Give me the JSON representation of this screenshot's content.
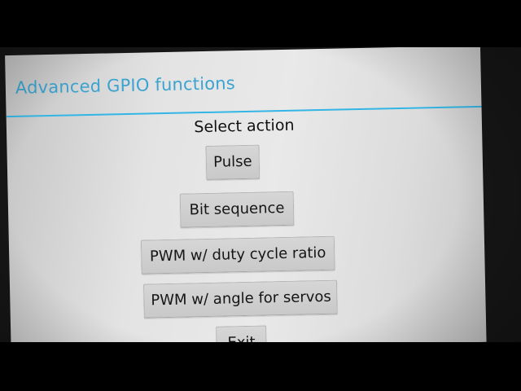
{
  "dialog": {
    "title": "Advanced GPIO functions",
    "prompt": "Select action",
    "accent_color": "#33b5e5"
  },
  "actions": {
    "pulse": "Pulse",
    "bit_sequence": "Bit sequence",
    "pwm_duty": "PWM w/ duty cycle ratio",
    "pwm_servo": "PWM w/ angle for servos",
    "exit": "Exit"
  }
}
